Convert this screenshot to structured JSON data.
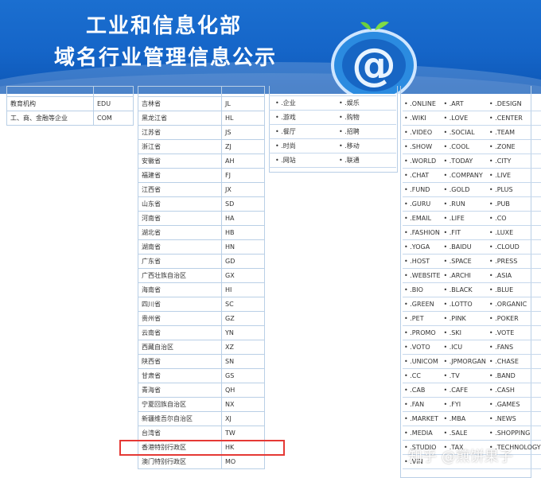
{
  "banner": {
    "title_line1": "工业和信息化部",
    "title_line2": "域名行业管理信息公示"
  },
  "category_table": [
    {
      "name": "教育机构",
      "code": "EDU"
    },
    {
      "name": "工、商、金融等企业",
      "code": "COM"
    }
  ],
  "province_table": [
    {
      "name": "吉林省",
      "code": "JL"
    },
    {
      "name": "黑龙江省",
      "code": "HL"
    },
    {
      "name": "江苏省",
      "code": "JS"
    },
    {
      "name": "浙江省",
      "code": "ZJ"
    },
    {
      "name": "安徽省",
      "code": "AH"
    },
    {
      "name": "福建省",
      "code": "FJ"
    },
    {
      "name": "江西省",
      "code": "JX"
    },
    {
      "name": "山东省",
      "code": "SD"
    },
    {
      "name": "河南省",
      "code": "HA"
    },
    {
      "name": "湖北省",
      "code": "HB"
    },
    {
      "name": "湖南省",
      "code": "HN"
    },
    {
      "name": "广东省",
      "code": "GD"
    },
    {
      "name": "广西壮族自治区",
      "code": "GX"
    },
    {
      "name": "海南省",
      "code": "HI"
    },
    {
      "name": "四川省",
      "code": "SC"
    },
    {
      "name": "贵州省",
      "code": "GZ"
    },
    {
      "name": "云南省",
      "code": "YN"
    },
    {
      "name": "西藏自治区",
      "code": "XZ"
    },
    {
      "name": "陕西省",
      "code": "SN"
    },
    {
      "name": "甘肃省",
      "code": "GS"
    },
    {
      "name": "青海省",
      "code": "QH"
    },
    {
      "name": "宁夏回族自治区",
      "code": "NX"
    },
    {
      "name": "新疆维吾尔自治区",
      "code": "XJ"
    },
    {
      "name": "台湾省",
      "code": "TW"
    },
    {
      "name": "香港特别行政区",
      "code": "HK"
    },
    {
      "name": "澳门特别行政区",
      "code": "MO"
    }
  ],
  "chinese_domains": [
    [
      ".企业",
      ".娱乐"
    ],
    [
      ".游戏",
      ".购物"
    ],
    [
      ".餐厅",
      ".招聘"
    ],
    [
      ".时尚",
      ".移动"
    ],
    [
      ".网站",
      ".联通"
    ]
  ],
  "gtld_domains": [
    [
      ".ONLINE",
      ".ART",
      ".DESIGN"
    ],
    [
      ".WIKI",
      ".LOVE",
      ".CENTER"
    ],
    [
      ".VIDEO",
      ".SOCIAL",
      ".TEAM"
    ],
    [
      ".SHOW",
      ".COOL",
      ".ZONE"
    ],
    [
      ".WORLD",
      ".TODAY",
      ".CITY"
    ],
    [
      ".CHAT",
      ".COMPANY",
      ".LIVE"
    ],
    [
      ".FUND",
      ".GOLD",
      ".PLUS"
    ],
    [
      ".GURU",
      ".RUN",
      ".PUB"
    ],
    [
      ".EMAIL",
      ".LIFE",
      ".CO"
    ],
    [
      ".FASHION",
      ".FIT",
      ".LUXE"
    ],
    [
      ".YOGA",
      ".BAIDU",
      ".CLOUD"
    ],
    [
      ".HOST",
      ".SPACE",
      ".PRESS"
    ],
    [
      ".WEBSITE",
      ".ARCHI",
      ".ASIA"
    ],
    [
      ".BIO",
      ".BLACK",
      ".BLUE"
    ],
    [
      ".GREEN",
      ".LOTTO",
      ".ORGANIC"
    ],
    [
      ".PET",
      ".PINK",
      ".POKER"
    ],
    [
      ".PROMO",
      ".SKI",
      ".VOTE"
    ],
    [
      ".VOTO",
      ".ICU",
      ".FANS"
    ],
    [
      ".UNICOM",
      ".JPMORGAN",
      ".CHASE"
    ],
    [
      ".CC",
      ".TV",
      ".BAND"
    ],
    [
      ".CAB",
      ".CAFE",
      ".CASH"
    ],
    [
      ".FAN",
      ".FYI",
      ".GAMES"
    ],
    [
      ".MARKET",
      ".MBA",
      ".NEWS"
    ],
    [
      ".MEDIA",
      ".SALE",
      ".SHOPPING"
    ],
    [
      ".STUDIO",
      ".TAX",
      ".TECHNOLOGY"
    ],
    [
      ".VIN",
      "",
      ""
    ]
  ],
  "watermark": "知乎 @煎饼果子",
  "colors": {
    "banner": "#1565c8",
    "table_border": "#b9cfe6",
    "highlight": "#e53935"
  }
}
